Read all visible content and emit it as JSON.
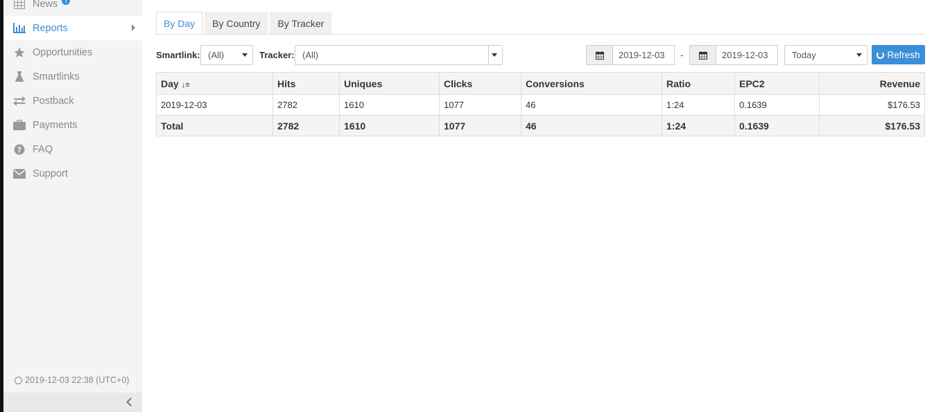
{
  "sidebar": {
    "items": [
      {
        "label": "News",
        "icon": "calendar-grid-icon",
        "badge": "!"
      },
      {
        "label": "Reports",
        "icon": "bar-chart-icon",
        "active": true
      },
      {
        "label": "Opportunities",
        "icon": "star-icon"
      },
      {
        "label": "Smartlinks",
        "icon": "flask-icon"
      },
      {
        "label": "Postback",
        "icon": "exchange-arrows-icon"
      },
      {
        "label": "Payments",
        "icon": "briefcase-icon"
      },
      {
        "label": "FAQ",
        "icon": "question-circle-icon"
      },
      {
        "label": "Support",
        "icon": "envelope-icon"
      }
    ],
    "clock": "2019-12-03 22:38 (UTC+0)"
  },
  "tabs": [
    {
      "label": "By Day",
      "active": true
    },
    {
      "label": "By Country"
    },
    {
      "label": "By Tracker"
    }
  ],
  "filters": {
    "smartlink_label": "Smartlink:",
    "smartlink_value": "(All)",
    "tracker_label": "Tracker:",
    "tracker_value": "(All)",
    "date_from": "2019-12-03",
    "date_to": "2019-12-03",
    "date_separator": "-",
    "period_value": "Today",
    "refresh_label": "Refresh"
  },
  "table": {
    "columns": [
      "Day",
      "Hits",
      "Uniques",
      "Clicks",
      "Conversions",
      "Ratio",
      "EPC2",
      "Revenue"
    ],
    "rows": [
      [
        "2019-12-03",
        "2782",
        "1610",
        "1077",
        "46",
        "1:24",
        "0.1639",
        "$176.53"
      ]
    ],
    "total": [
      "Total",
      "2782",
      "1610",
      "1077",
      "46",
      "1:24",
      "0.1639",
      "$176.53"
    ]
  },
  "colors": {
    "accent": "#3b8ed8",
    "sidebar_bg": "#f4f4f4"
  }
}
